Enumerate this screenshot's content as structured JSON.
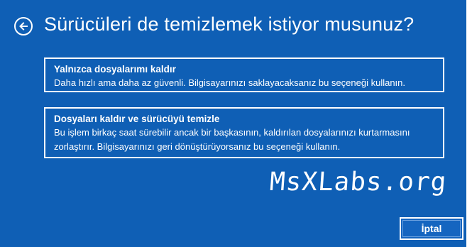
{
  "header": {
    "title": "Sürücüleri de temizlemek istiyor musunuz?"
  },
  "options": [
    {
      "title": "Yalnızca dosyalarımı kaldır",
      "description": "Daha hızlı ama daha az güvenli. Bilgisayarınızı saklayacaksanız bu seçeneği kullanın."
    },
    {
      "title": "Dosyaları kaldır ve sürücüyü temizle",
      "description": "Bu işlem birkaç saat sürebilir ancak bir başkasının, kaldırılan dosyalarınızı kurtarmasını zorlaştırır. Bilgisayarınızı geri dönüştürüyorsanız bu seçeneği kullanın."
    }
  ],
  "watermark": "MsXLabs.org",
  "footer": {
    "cancel_label": "İptal"
  },
  "colors": {
    "background": "#0f5fb5",
    "text": "#ffffff"
  }
}
